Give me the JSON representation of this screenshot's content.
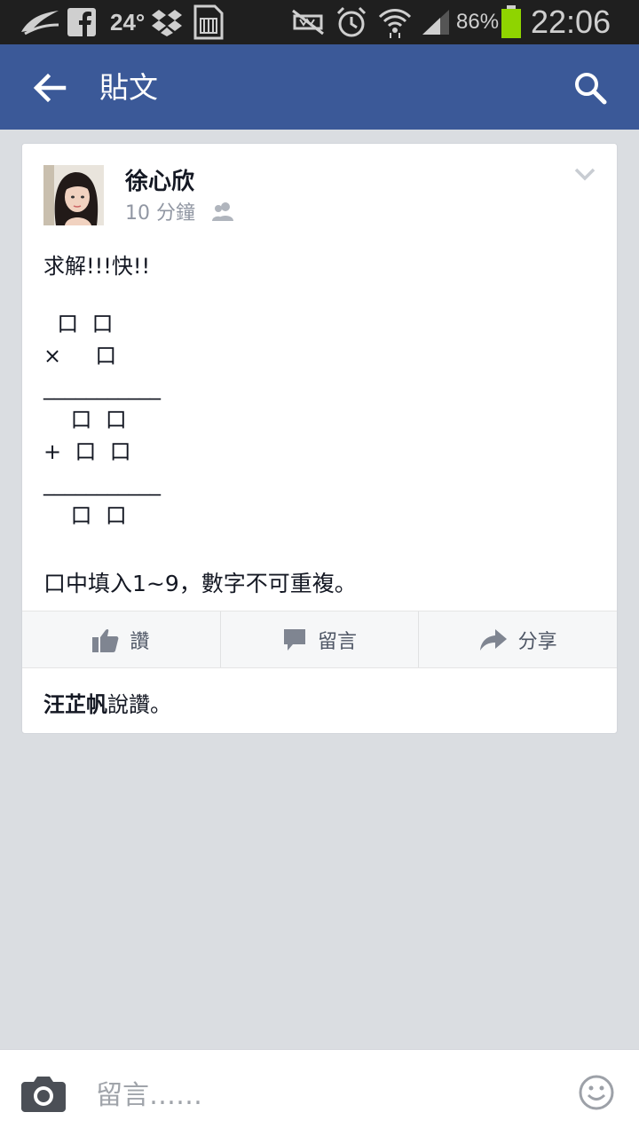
{
  "status_bar": {
    "temperature": "24°",
    "battery": "86%",
    "time": "22:06"
  },
  "app_bar": {
    "title": "貼文"
  },
  "post": {
    "author": "徐心欣",
    "time_ago": "10 分鐘",
    "text": "求解!!!快!!",
    "puzzle_lines": [
      "  口  口",
      "×     口",
      "___________",
      "    口  口",
      "+  口  口",
      "___________",
      "    口  口"
    ],
    "rule": "口中填入1~9，數字不可重複。",
    "actions": {
      "like": "讚",
      "comment": "留言",
      "share": "分享"
    },
    "likes": {
      "name": "汪芷帆",
      "suffix": "說讚。"
    }
  },
  "composer": {
    "placeholder": "留言……"
  },
  "colors": {
    "appbar": "#3b5998",
    "background": "#dadde1",
    "battery": "#8fd400"
  }
}
